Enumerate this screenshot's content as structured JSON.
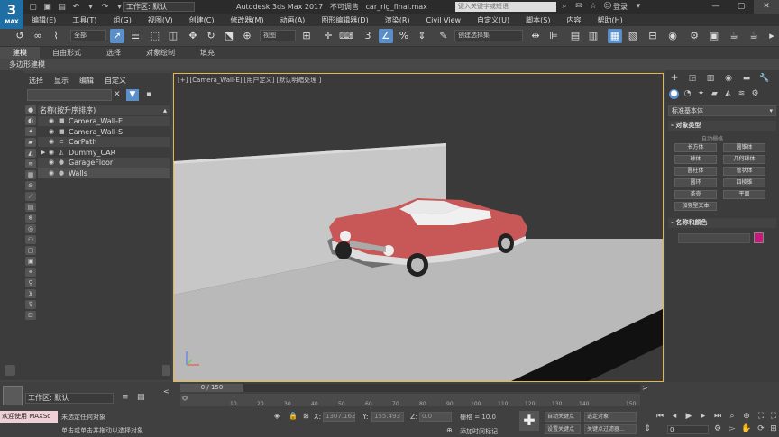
{
  "app": {
    "logo_text": "3",
    "logo_sub": "MAX",
    "workspace_label": "工作区: 默认",
    "title": "Autodesk 3ds Max 2017",
    "not_saved": "不可调售",
    "filename": "car_rig_final.max",
    "search_placeholder": "键入关键字或短语",
    "login": "登录"
  },
  "menu": [
    "编辑(E)",
    "工具(T)",
    "组(G)",
    "视图(V)",
    "创建(C)",
    "修改器(M)",
    "动画(A)",
    "图形编辑器(D)",
    "渲染(R)",
    "Civil View",
    "自定义(U)",
    "脚本(S)",
    "内容",
    "帮助(H)"
  ],
  "toolbar": {
    "selection_filter": "全部",
    "ref_coord": "视图",
    "named_selection": "创建选择集"
  },
  "ribbon": {
    "tabs": [
      "建模",
      "自由形式",
      "选择",
      "对象绘制",
      "填充"
    ],
    "active_tab": "建模",
    "subtitle": "多边形建模"
  },
  "scene_explorer": {
    "tabs": [
      "选择",
      "显示",
      "编辑",
      "自定义"
    ],
    "header": "名称(按升序排序)",
    "items": [
      {
        "name": "Camera_Wall-E",
        "type": "camera"
      },
      {
        "name": "Camera_Wall-S",
        "type": "camera"
      },
      {
        "name": "CarPath",
        "type": "shape"
      },
      {
        "name": "Dummy_CAR",
        "type": "helper"
      },
      {
        "name": "GarageFloor",
        "type": "geometry"
      },
      {
        "name": "Walls",
        "type": "geometry"
      }
    ]
  },
  "viewport": {
    "label": "[+] [Camera_Wall-E] [用户定义] [默认明暗处理 ]"
  },
  "command_panel": {
    "dropdown": "标准基本体",
    "rollout1": "对象类型",
    "autogrid": "自动栅格",
    "buttons": [
      "长方体",
      "圆锥体",
      "球体",
      "几何球体",
      "圆柱体",
      "管状体",
      "圆环",
      "四棱锥",
      "茶壶",
      "平面",
      "加强型文本"
    ],
    "rollout2": "名称和颜色",
    "object_color": "#c51a7b"
  },
  "bottom": {
    "workspace": "工作区: 默认",
    "time_slider": "0 / 150",
    "ticks": [
      "10",
      "20",
      "30",
      "40",
      "50",
      "60",
      "70",
      "80",
      "90",
      "100",
      "110",
      "120",
      "130",
      "140",
      "150"
    ],
    "welcome": "欢迎使用 MAXSc",
    "status_line1": "未选定任何对象",
    "status_line2": "单击或单击并拖动以选择对象",
    "x_label": "X:",
    "x_value": "1307.162",
    "y_label": "Y:",
    "y_value": "155.493",
    "z_label": "Z:",
    "z_value": "0.0",
    "grid": "栅格 = 10.0",
    "add_time_tag": "添加时间标记",
    "auto_key": "自动关键点",
    "set_key": "设置关键点",
    "selected": "选定对象",
    "key_filters": "关键点过滤器...",
    "frame": "0"
  }
}
